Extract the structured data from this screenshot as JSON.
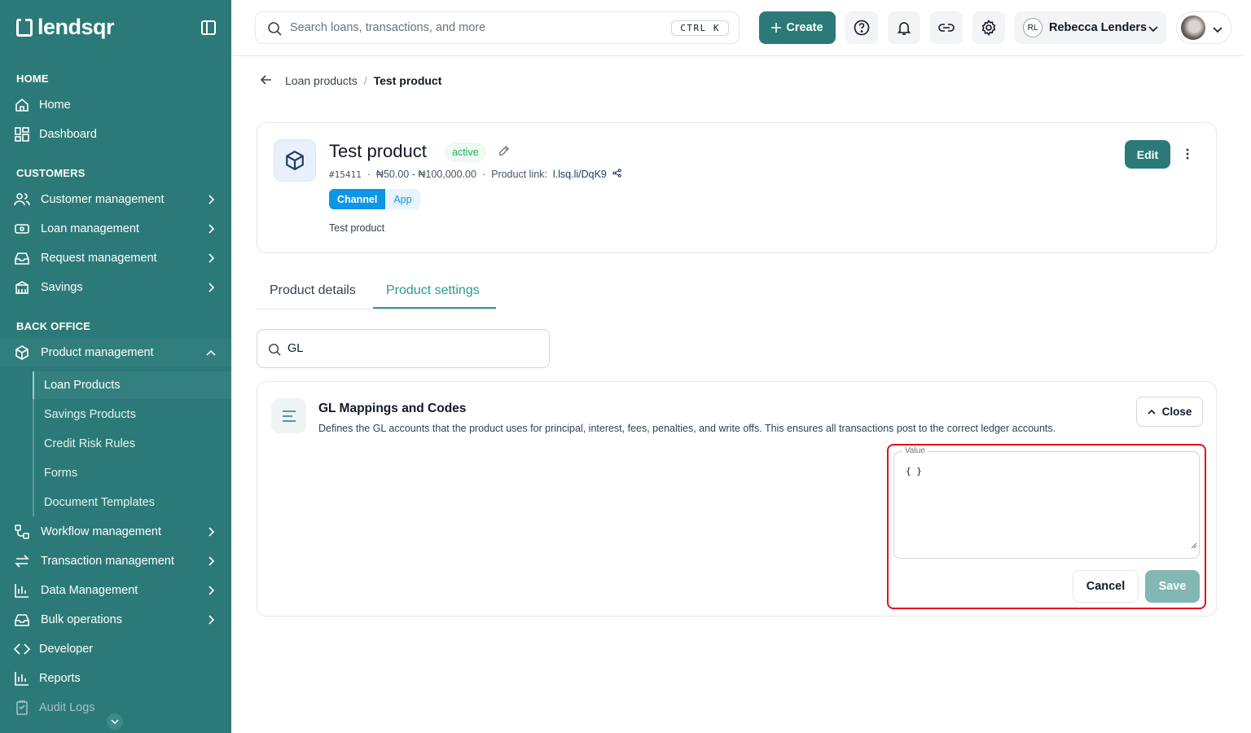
{
  "brand": {
    "name": "lendsqr"
  },
  "colors": {
    "brand": "#2b7a78",
    "accent": "#2b9a8e",
    "status_active": "#22b35b",
    "channel": "#0d96e4",
    "highlight": "#e1121c"
  },
  "sidebar": {
    "sections": {
      "home": "HOME",
      "customers": "CUSTOMERS",
      "back_office": "BACK OFFICE"
    },
    "items": {
      "home": "Home",
      "dashboard": "Dashboard",
      "customer_management": "Customer management",
      "loan_management": "Loan management",
      "request_management": "Request management",
      "savings": "Savings",
      "product_management": "Product management",
      "workflow_management": "Workflow management",
      "transaction_management": "Transaction management",
      "data_management": "Data Management",
      "bulk_operations": "Bulk operations",
      "developer": "Developer",
      "reports": "Reports",
      "audit_logs": "Audit Logs"
    },
    "sub_items": {
      "loan_products": "Loan Products",
      "savings_products": "Savings Products",
      "credit_risk_rules": "Credit Risk Rules",
      "forms": "Forms",
      "document_templates": "Document Templates"
    }
  },
  "topbar": {
    "search_placeholder": "Search loans, transactions, and more",
    "shortcut": "CTRL K",
    "create_label": "Create",
    "org_initials": "RL",
    "org_name": "Rebecca Lenders"
  },
  "breadcrumb": {
    "parent": "Loan products",
    "separator": "/",
    "current": "Test product"
  },
  "product": {
    "title": "Test product",
    "status": "active",
    "id": "#15411",
    "range": "₦50.00 - ₦100,000.00",
    "link_label": "Product link:",
    "link": "l.lsq.li/DqK9",
    "channel_label": "Channel",
    "channel_value": "App",
    "description": "Test product",
    "edit_label": "Edit"
  },
  "tabs": {
    "details": "Product details",
    "settings": "Product settings"
  },
  "filter": {
    "value": "GL"
  },
  "gl_section": {
    "title": "GL Mappings and Codes",
    "description": "Defines the GL accounts that the product uses for principal, interest, fees, penalties, and write offs. This ensures all transactions post to the correct ledger accounts.",
    "close_label": "Close",
    "value_label": "Value",
    "value": "{ }",
    "cancel_label": "Cancel",
    "save_label": "Save"
  }
}
